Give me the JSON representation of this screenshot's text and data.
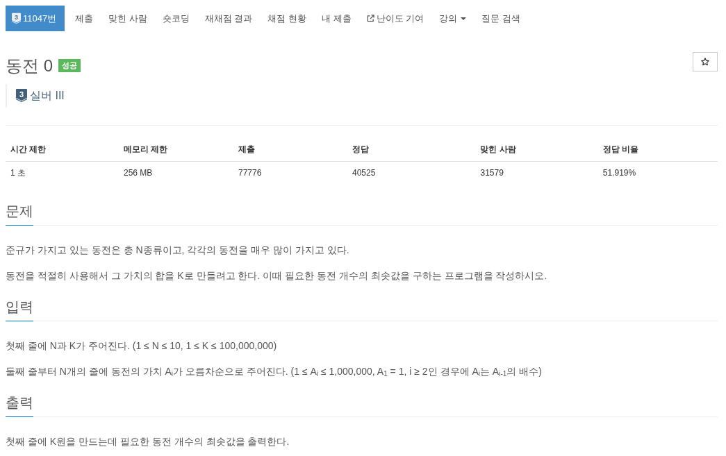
{
  "nav": {
    "items": [
      {
        "kind": "problem",
        "tier_badge": "3",
        "label": "11047번",
        "selected": true
      },
      {
        "kind": "link",
        "label": "제출",
        "selected": false
      },
      {
        "kind": "link",
        "label": "맞힌 사람",
        "selected": false
      },
      {
        "kind": "link",
        "label": "숏코딩",
        "selected": false
      },
      {
        "kind": "link",
        "label": "재채점 결과",
        "selected": false
      },
      {
        "kind": "link",
        "label": "채점 현황",
        "selected": false
      },
      {
        "kind": "link",
        "label": "내 제출",
        "selected": false
      },
      {
        "kind": "external",
        "label": "난이도 기여",
        "selected": false
      },
      {
        "kind": "dropdown",
        "label": "강의",
        "selected": false
      },
      {
        "kind": "link",
        "label": "질문 검색",
        "selected": false
      }
    ]
  },
  "problem": {
    "title": "동전 0",
    "result": {
      "label": "성공",
      "kind": "success"
    },
    "tier": {
      "badge": "3",
      "label": "실버 III"
    }
  },
  "limits_table": {
    "columns": [
      "시간 제한",
      "메모리 제한",
      "제출",
      "정답",
      "맞힌 사람",
      "정답 비율"
    ],
    "rows": [
      [
        "1 초",
        "256 MB",
        "77776",
        "40525",
        "31579",
        "51.919%"
      ]
    ]
  },
  "sections": [
    {
      "heading": "문제",
      "paragraphs": [
        "준규가 가지고 있는 동전은 총 N종류이고, 각각의 동전을 매우 많이 가지고 있다.",
        "동전을 적절히 사용해서 그 가치의 합을 K로 만들려고 한다. 이때 필요한 동전 개수의 최솟값을 구하는 프로그램을 작성하시오."
      ]
    },
    {
      "heading": "입력",
      "paragraphs": [
        "첫째 줄에 N과 K가 주어진다. (1 ≤ N ≤ 10, 1 ≤ K ≤ 100,000,000)",
        "둘째 줄부터 N개의 줄에 동전의 가치 A$_{i}$가 오름차순으로 주어진다. (1 ≤ A$_{i}$ ≤ 1,000,000, A$_{1}$ = 1, i ≥ 2인 경우에 A$_{i}$는 A$_{i-1}$의 배수)"
      ]
    },
    {
      "heading": "출력",
      "paragraphs": [
        "첫째 줄에 K원을 만드는데 필요한 동전 개수의 최솟값을 출력한다."
      ]
    }
  ]
}
